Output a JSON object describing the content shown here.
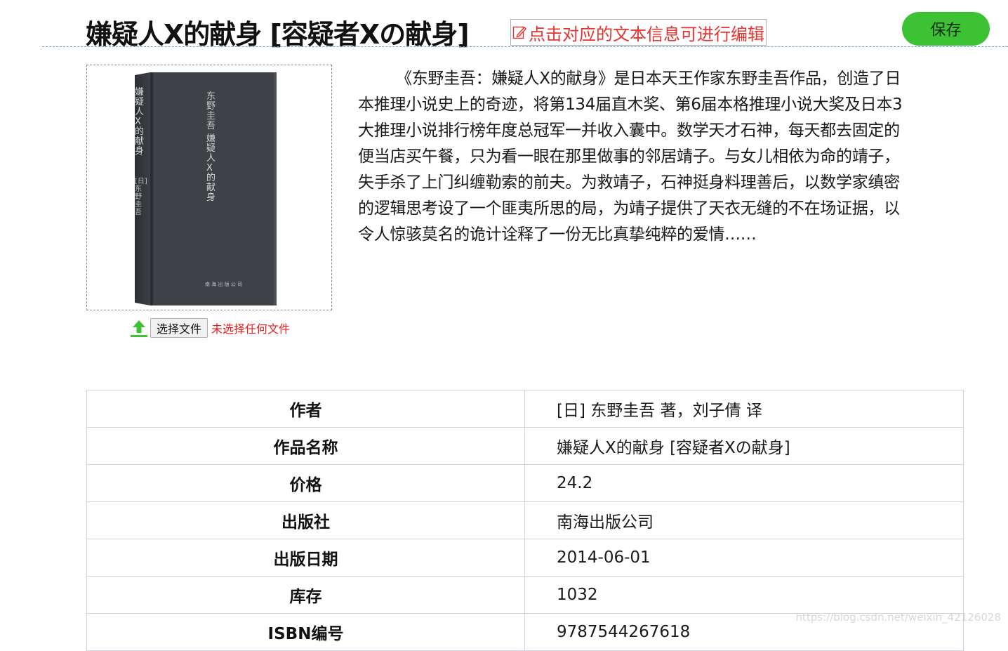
{
  "header": {
    "title": "嫌疑人X的献身 [容疑者Xの献身]",
    "edit_hint": "点击对应的文本信息可进行编辑",
    "edit_icon": "edit-icon",
    "save_label": "保存"
  },
  "cover": {
    "spine_title": "嫌疑人X的献身",
    "spine_author": "[日] 东野圭吾",
    "front_author": "东野圭吾",
    "front_title": "嫌疑人X的献身"
  },
  "upload": {
    "button_label": "选择文件",
    "status": "未选择任何文件",
    "icon": "upload-icon"
  },
  "description": "《东野圭吾：嫌疑人X的献身》是日本天王作家东野圭吾作品，创造了日本推理小说史上的奇迹，将第134届直木奖、第6届本格推理小说大奖及日本3大推理小说排行榜年度总冠军一并收入囊中。数学天才石神，每天都去固定的便当店买午餐，只为看一眼在那里做事的邻居靖子。与女儿相依为命的靖子，失手杀了上门纠缠勒索的前夫。为救靖子，石神挺身料理善后，以数学家缜密的逻辑思考设了一个匪夷所思的局，为靖子提供了天衣无缝的不在场证据，以令人惊骇莫名的诡计诠释了一份无比真挚纯粹的爱情……",
  "info_table": [
    {
      "label": "作者",
      "value": "[日] 东野圭吾 著，刘子倩 译"
    },
    {
      "label": "作品名称",
      "value": "嫌疑人X的献身 [容疑者Xの献身]"
    },
    {
      "label": "价格",
      "value": "24.2"
    },
    {
      "label": "出版社",
      "value": "南海出版公司"
    },
    {
      "label": "出版日期",
      "value": "2014-06-01"
    },
    {
      "label": "库存",
      "value": "1032"
    },
    {
      "label": "ISBN编号",
      "value": "9787544267618"
    }
  ],
  "watermark": "https://blog.csdn.net/weixin_42126028",
  "colors": {
    "save_button": "#3cc232",
    "edit_hint": "#e8332d",
    "file_status": "#e81e1e",
    "header_rule": "#5aa9d6"
  }
}
